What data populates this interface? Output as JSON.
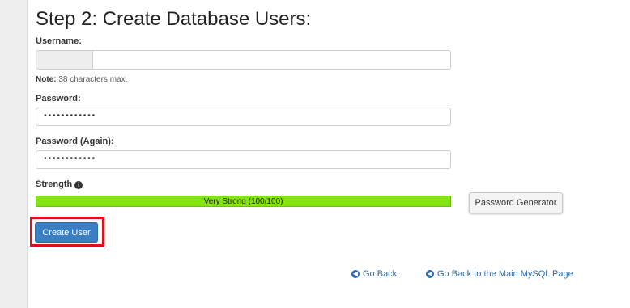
{
  "page": {
    "title": "Step 2: Create Database Users:"
  },
  "form": {
    "username_label": "Username:",
    "username_value": "",
    "note_bold": "Note:",
    "note_text": "38 characters max.",
    "password_label": "Password:",
    "password_value": "••••••••••••",
    "password_again_label": "Password (Again):",
    "password_again_value": "••••••••••••",
    "strength_label": "Strength",
    "strength_text": "Very Strong (100/100)",
    "strength_value": 100
  },
  "buttons": {
    "password_generator": "Password Generator",
    "create_user": "Create User"
  },
  "links": {
    "go_back": "Go Back",
    "go_back_main": "Go Back to the Main MySQL Page"
  },
  "colors": {
    "strength_bar": "#84e40d",
    "primary_button": "#3a7ec4",
    "highlight": "#e0101a",
    "link": "#2f6aa8"
  },
  "icons": {
    "info": "info-icon",
    "back_arrow": "arrow-left-circle-icon"
  }
}
